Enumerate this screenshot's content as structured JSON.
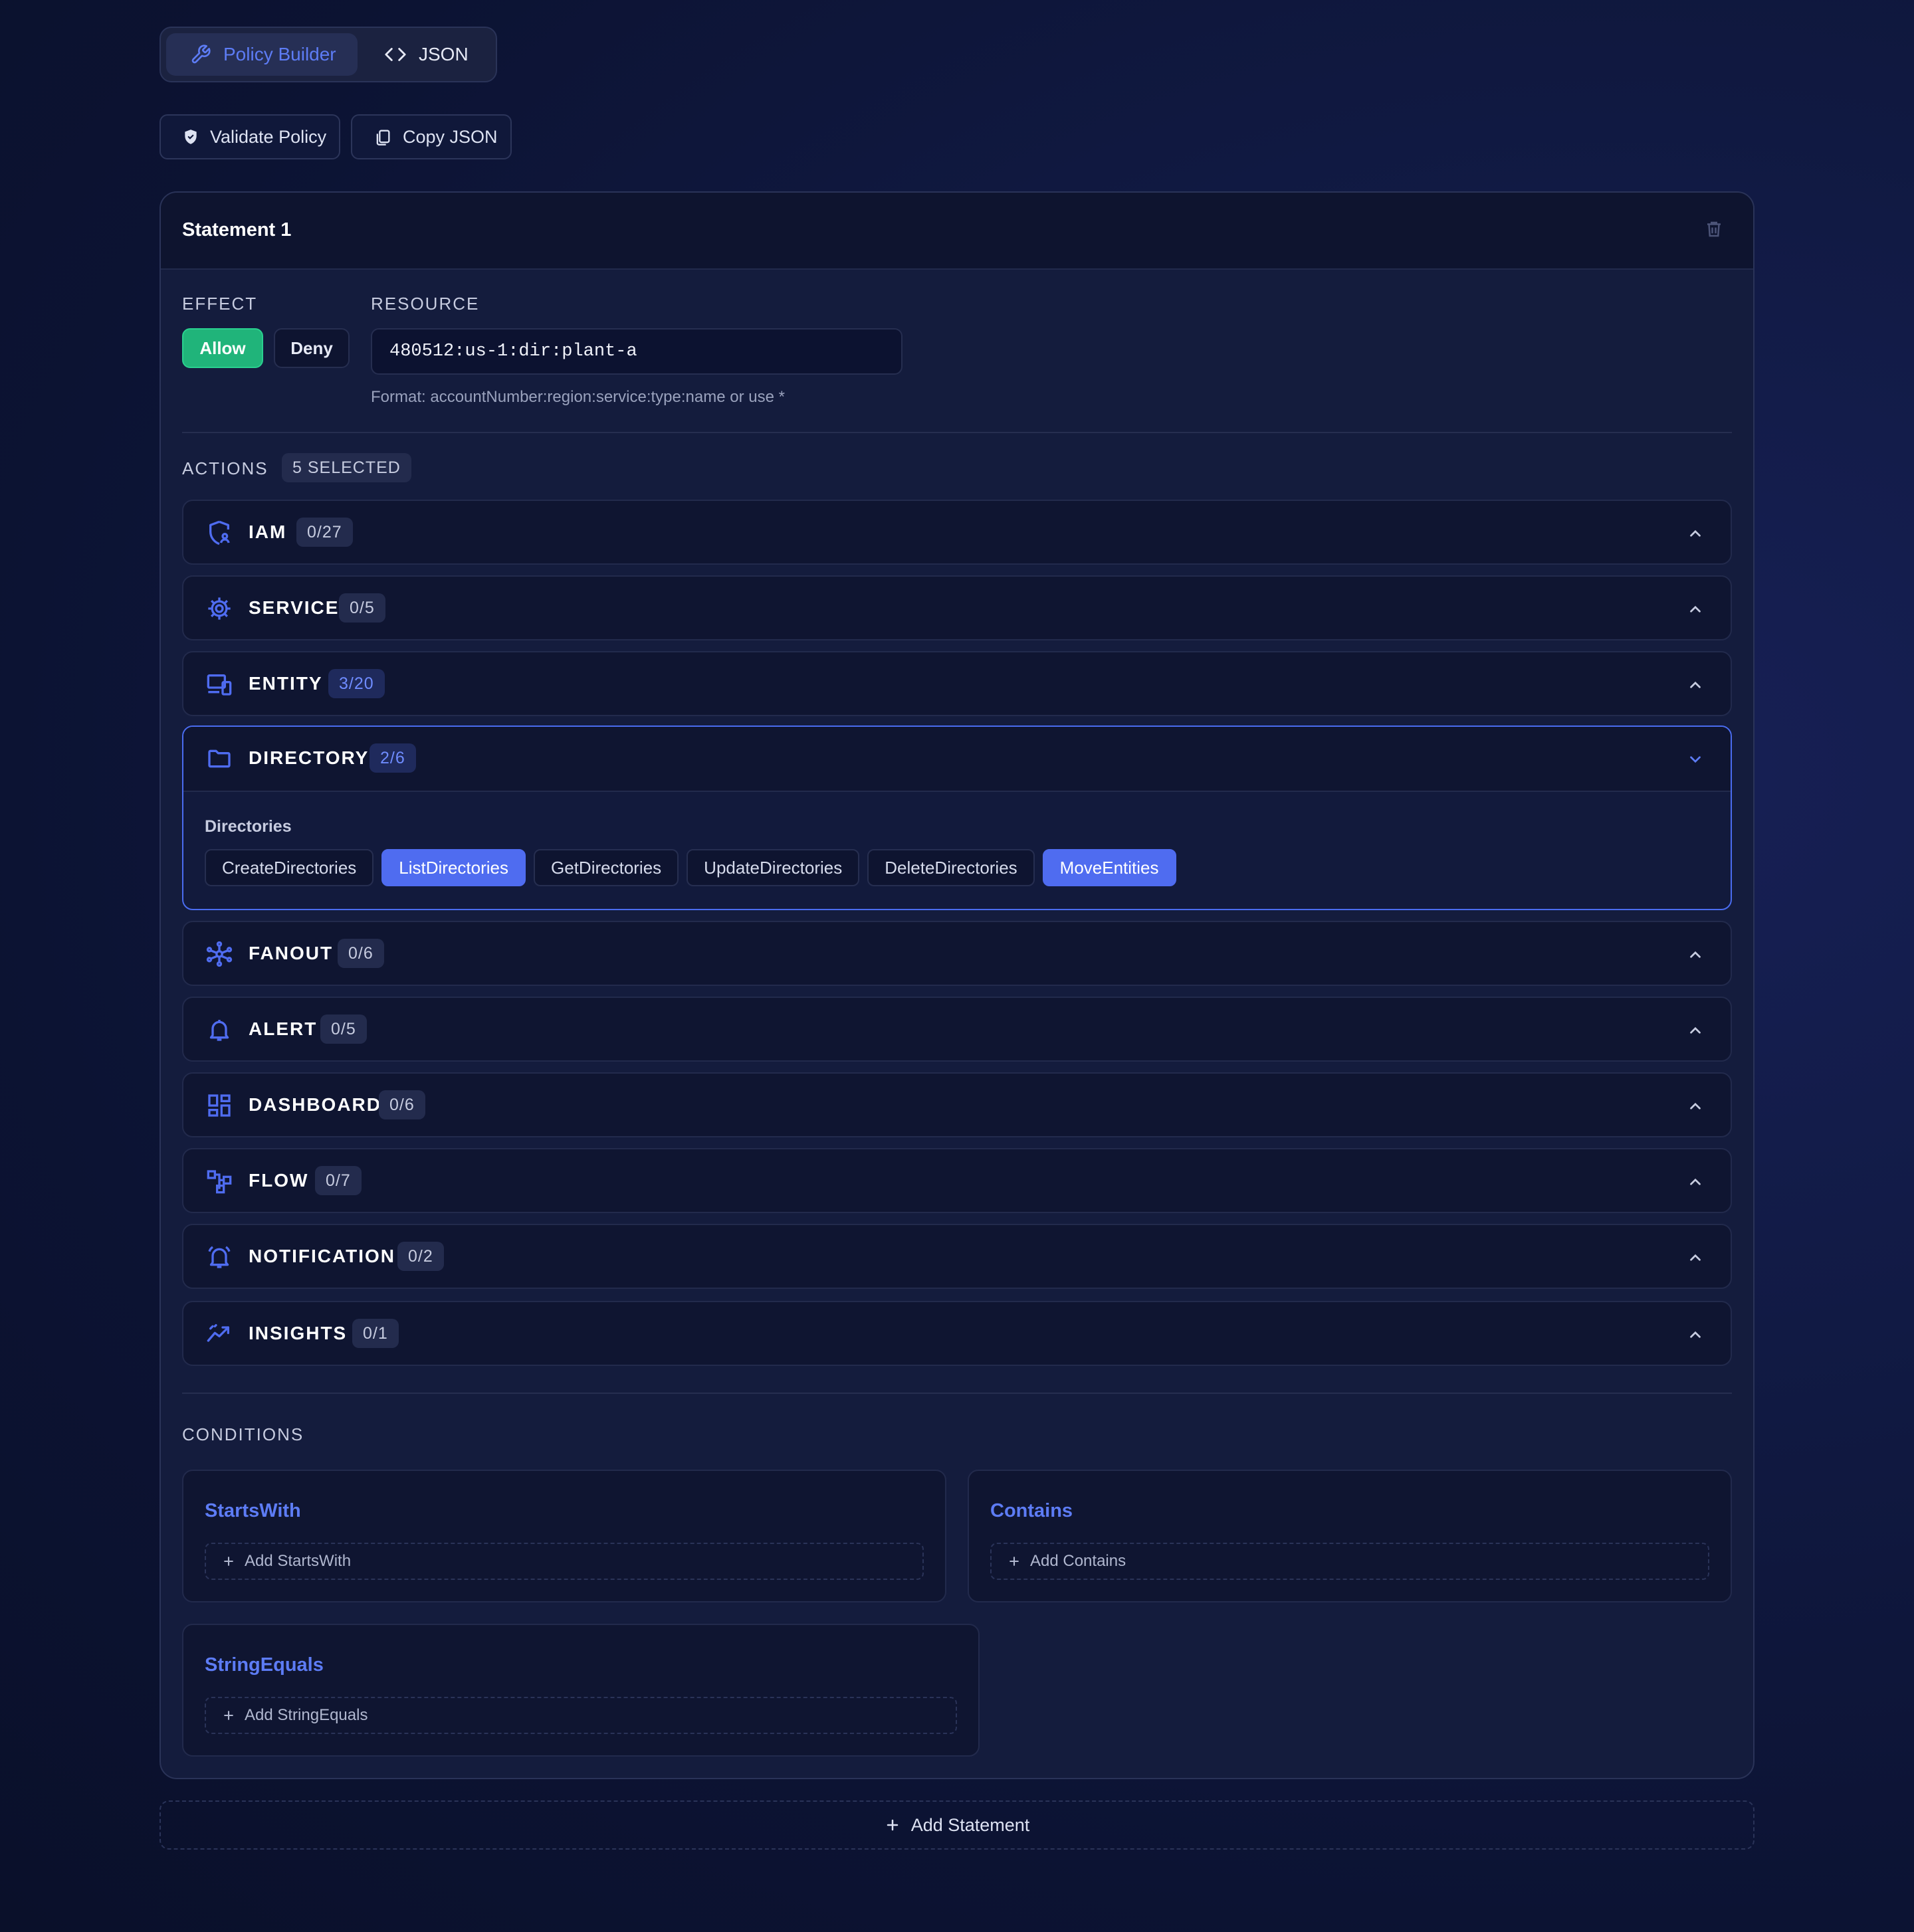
{
  "view_toggle": {
    "builder_label": "Policy Builder",
    "json_label": "JSON"
  },
  "toolbar": {
    "validate_label": "Validate Policy",
    "copy_label": "Copy JSON"
  },
  "statement": {
    "title": "Statement 1",
    "effect_label": "EFFECT",
    "allow_label": "Allow",
    "deny_label": "Deny",
    "selected_effect": "Allow",
    "resource_label": "RESOURCE",
    "resource_value": "480512:us-1:dir:plant-a",
    "resource_hint": "Format: accountNumber:region:service:type:name or use *"
  },
  "actions": {
    "label": "ACTIONS",
    "selected_badge": "5 SELECTED",
    "groups": [
      {
        "name": "IAM",
        "count": "0/27",
        "icon": "shield-user-icon"
      },
      {
        "name": "SERVICE",
        "count": "0/5",
        "icon": "gear-icon"
      },
      {
        "name": "ENTITY",
        "count": "3/20",
        "icon": "devices-icon"
      },
      {
        "name": "DIRECTORY",
        "count": "2/6",
        "icon": "folder-icon",
        "expanded": true,
        "sub_label": "Directories",
        "options": [
          {
            "label": "CreateDirectories",
            "selected": false
          },
          {
            "label": "ListDirectories",
            "selected": true
          },
          {
            "label": "GetDirectories",
            "selected": false
          },
          {
            "label": "UpdateDirectories",
            "selected": false
          },
          {
            "label": "DeleteDirectories",
            "selected": false
          },
          {
            "label": "MoveEntities",
            "selected": true
          }
        ]
      },
      {
        "name": "FANOUT",
        "count": "0/6",
        "icon": "hub-icon"
      },
      {
        "name": "ALERT",
        "count": "0/5",
        "icon": "bell-icon"
      },
      {
        "name": "DASHBOARD",
        "count": "0/6",
        "icon": "dashboard-icon"
      },
      {
        "name": "FLOW",
        "count": "0/7",
        "icon": "flow-icon"
      },
      {
        "name": "NOTIFICATION",
        "count": "0/2",
        "icon": "alarm-bell-icon"
      },
      {
        "name": "INSIGHTS",
        "count": "0/1",
        "icon": "trend-icon"
      }
    ]
  },
  "conditions": {
    "label": "CONDITIONS",
    "items": [
      {
        "title": "StartsWith",
        "add_label": "Add StartsWith"
      },
      {
        "title": "Contains",
        "add_label": "Add Contains"
      },
      {
        "title": "StringEquals",
        "add_label": "Add StringEquals"
      }
    ]
  },
  "add_statement_label": "Add Statement",
  "colors": {
    "accent": "#4f6cf0",
    "allow": "#20b47a",
    "background": "#0c1333"
  }
}
